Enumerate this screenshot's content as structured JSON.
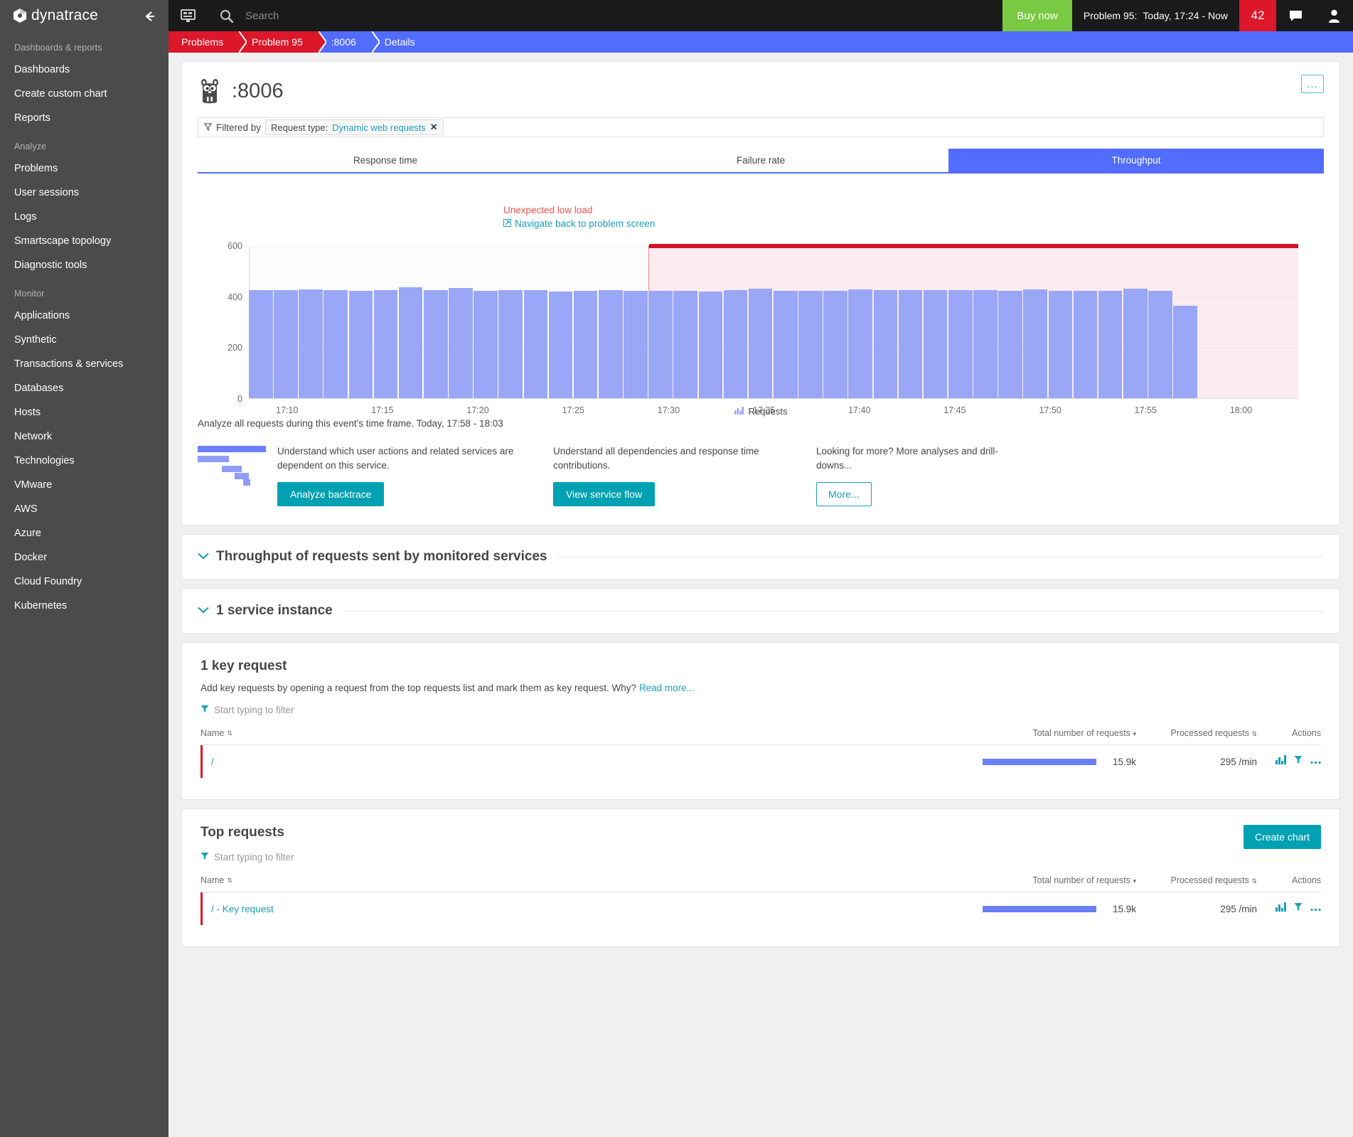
{
  "brand": {
    "name": "dynatrace",
    "accent": "#526cfe",
    "danger": "#dc172a",
    "teal": "#00a1b2",
    "green": "#7ac943"
  },
  "topbar": {
    "search_placeholder": "Search",
    "buy_now": "Buy now",
    "problem_label": "Problem 95:",
    "problem_time": "Today, 17:24 - Now",
    "problem_count": "42",
    "dashboard_icon": "dashboard-icon",
    "search_icon": "search-icon",
    "chat_icon": "chat-icon",
    "user_icon": "user-icon"
  },
  "breadcrumb": [
    {
      "label": "Problems",
      "style": "red"
    },
    {
      "label": "Problem 95",
      "style": "red"
    },
    {
      "label": ":8006",
      "style": "blue"
    },
    {
      "label": "Details",
      "style": "blue"
    }
  ],
  "sidebar": {
    "collapse_icon": "arrow-left-icon",
    "groups": [
      {
        "title": "Dashboards & reports",
        "items": [
          "Dashboards",
          "Create custom chart",
          "Reports"
        ]
      },
      {
        "title": "Analyze",
        "items": [
          "Problems",
          "User sessions",
          "Logs",
          "Smartscape topology",
          "Diagnostic tools"
        ]
      },
      {
        "title": "Monitor",
        "items": [
          "Applications",
          "Synthetic",
          "Transactions & services",
          "Databases",
          "Hosts",
          "Network",
          "Technologies",
          "VMware",
          "AWS",
          "Azure",
          "Docker",
          "Cloud Foundry",
          "Kubernetes"
        ]
      }
    ]
  },
  "service": {
    "title": ":8006",
    "icon": "go-gopher-icon",
    "overflow_label": "...",
    "filter": {
      "prefix": "Filtered by",
      "chip_key": "Request type:",
      "chip_value": "Dynamic web requests",
      "chip_remove": "✕"
    },
    "tabs": [
      {
        "label": "Response time",
        "active": false
      },
      {
        "label": "Failure rate",
        "active": false
      },
      {
        "label": "Throughput",
        "active": true
      }
    ],
    "annotation": {
      "title": "Unexpected low load",
      "link": "Navigate back to problem screen"
    },
    "analyze_line": "Analyze all requests during this event's time frame. Today, 17:58 - 18:03",
    "promos": [
      {
        "icon": "backtrace-icon",
        "text": "Understand which user actions and related services are dependent on this service.",
        "button": "Analyze backtrace",
        "style": "solid"
      },
      {
        "icon": "",
        "text": "Understand all dependencies and response time contributions.",
        "button": "View service flow",
        "style": "solid"
      },
      {
        "icon": "",
        "text": "Looking for more? More analyses and drill-downs...",
        "button": "More...",
        "style": "outline"
      }
    ]
  },
  "chart_data": {
    "type": "bar",
    "title": "",
    "xlabel": "",
    "ylabel": "",
    "ylim": [
      0,
      600
    ],
    "yticks": [
      0,
      200,
      400,
      600
    ],
    "xticks": [
      "17:10",
      "17:15",
      "17:20",
      "17:25",
      "17:30",
      "17:35",
      "17:40",
      "17:45",
      "17:50",
      "17:55",
      "18:00"
    ],
    "legend": [
      {
        "name": "Requests",
        "color": "#9aa7f7"
      }
    ],
    "legend_position": "bottom",
    "grid": true,
    "annotation_band": {
      "label": "Unexpected low load",
      "color": "#dc172a",
      "start_x": "17:24",
      "end_x": "18:03"
    },
    "categories": [
      "17:08",
      "17:09",
      "17:10",
      "17:11",
      "17:12",
      "17:13",
      "17:14",
      "17:15",
      "17:16",
      "17:17",
      "17:18",
      "17:19",
      "17:20",
      "17:21",
      "17:22",
      "17:23",
      "17:24",
      "17:25",
      "17:26",
      "17:27",
      "17:28",
      "17:29",
      "17:30",
      "17:31",
      "17:32",
      "17:33",
      "17:34",
      "17:35",
      "17:36",
      "17:37",
      "17:38",
      "17:39",
      "17:40",
      "17:41",
      "17:42",
      "17:43",
      "17:44",
      "17:45",
      "17:46",
      "17:47",
      "17:48",
      "17:49"
    ],
    "values": [
      425,
      425,
      430,
      425,
      424,
      426,
      437,
      425,
      434,
      424,
      425,
      425,
      420,
      424,
      425,
      424,
      424,
      424,
      421,
      425,
      431,
      424,
      424,
      424,
      430,
      425,
      425,
      425,
      425,
      425,
      424,
      429,
      424,
      424,
      424,
      433,
      424,
      365,
      0,
      0,
      0,
      0
    ]
  },
  "sections": [
    {
      "title": "Throughput of requests sent by monitored services",
      "chevron": "chevron-down-icon"
    },
    {
      "title": "1 service instance",
      "chevron": "chevron-down-icon"
    }
  ],
  "key_requests": {
    "heading": "1 key request",
    "subtext": "Add key requests by opening a request from the top requests list and mark them as key request. Why?",
    "subtext_link": "Read more...",
    "filter_placeholder": "Start typing to filter",
    "columns": [
      {
        "label": "Name",
        "sort": "both"
      },
      {
        "label": "Total number of requests",
        "sort": "desc"
      },
      {
        "label": "Processed requests",
        "sort": "both"
      },
      {
        "label": "Actions",
        "sort": "none"
      }
    ],
    "rows": [
      {
        "name": "/",
        "total": "15.9k",
        "bar_pct": 100,
        "processed": "295 /min",
        "actions": [
          "chart-icon",
          "filter-icon",
          "more-icon"
        ]
      }
    ]
  },
  "top_requests": {
    "heading": "Top requests",
    "create_chart": "Create chart",
    "filter_placeholder": "Start typing to filter",
    "columns": [
      {
        "label": "Name",
        "sort": "both"
      },
      {
        "label": "Total number of requests",
        "sort": "desc"
      },
      {
        "label": "Processed requests",
        "sort": "both"
      },
      {
        "label": "Actions",
        "sort": "none"
      }
    ],
    "rows": [
      {
        "name": "/ - Key request",
        "total": "15.9k",
        "bar_pct": 100,
        "processed": "295 /min",
        "actions": [
          "chart-icon",
          "filter-icon",
          "more-icon"
        ]
      }
    ]
  }
}
